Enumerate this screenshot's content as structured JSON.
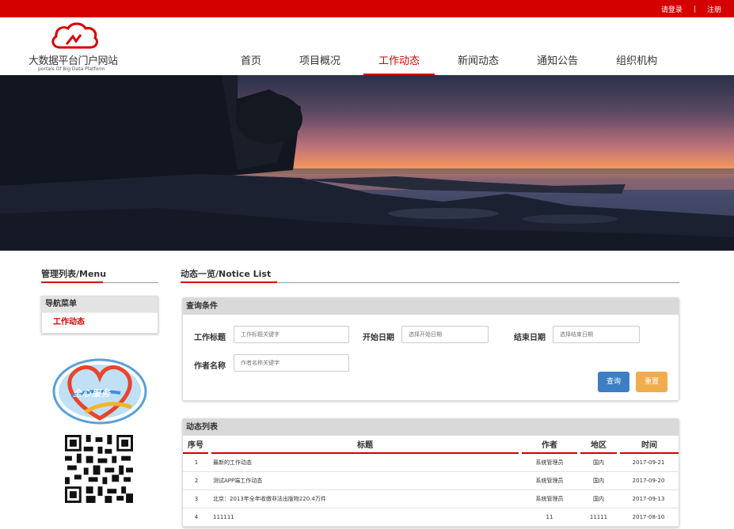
{
  "topbar": {
    "login": "请登录",
    "register": "注册"
  },
  "logo": {
    "name": "大数据平台门户网站",
    "sub": "portals Of Big Data Platform"
  },
  "nav": [
    {
      "label": "首页",
      "active": false
    },
    {
      "label": "项目概况",
      "active": false
    },
    {
      "label": "工作动态",
      "active": true
    },
    {
      "label": "新闻动态",
      "active": false
    },
    {
      "label": "通知公告",
      "active": false
    },
    {
      "label": "组织机构",
      "active": false
    }
  ],
  "left": {
    "title": "管理列表/Menu",
    "menu_header": "导航菜单",
    "menu_item": "工作动态",
    "emblem_text": "全心服务"
  },
  "main": {
    "title": "动态一览/Notice List",
    "query": {
      "header": "查询条件",
      "title_label": "工作标题",
      "title_placeholder": "工作标题关键字",
      "start_label": "开始日期",
      "start_placeholder": "选择开始日期",
      "end_label": "结束日期",
      "end_placeholder": "选择结束日期",
      "author_label": "作者名称",
      "author_placeholder": "作者名称关键字",
      "search_button": "查询",
      "reset_button": "重置"
    },
    "list": {
      "header": "动态列表",
      "columns": [
        "序号",
        "标题",
        "作者",
        "地区",
        "时间"
      ],
      "rows": [
        [
          "1",
          "最新的工作动态",
          "系统管理员",
          "国内",
          "2017-09-21"
        ],
        [
          "2",
          "测试APP端工作动态",
          "系统管理员",
          "国内",
          "2017-09-20"
        ],
        [
          "3",
          "北京：2013年全年收缴非法出版物220.4万件",
          "系统管理员",
          "国内",
          "2017-09-13"
        ],
        [
          "4",
          "111111",
          "11",
          "11111",
          "2017-08-10"
        ]
      ]
    }
  },
  "colors": {
    "brand_red": "#d40000",
    "query_blue": "#3c7fc4",
    "reset_orange": "#f0ad4e"
  }
}
